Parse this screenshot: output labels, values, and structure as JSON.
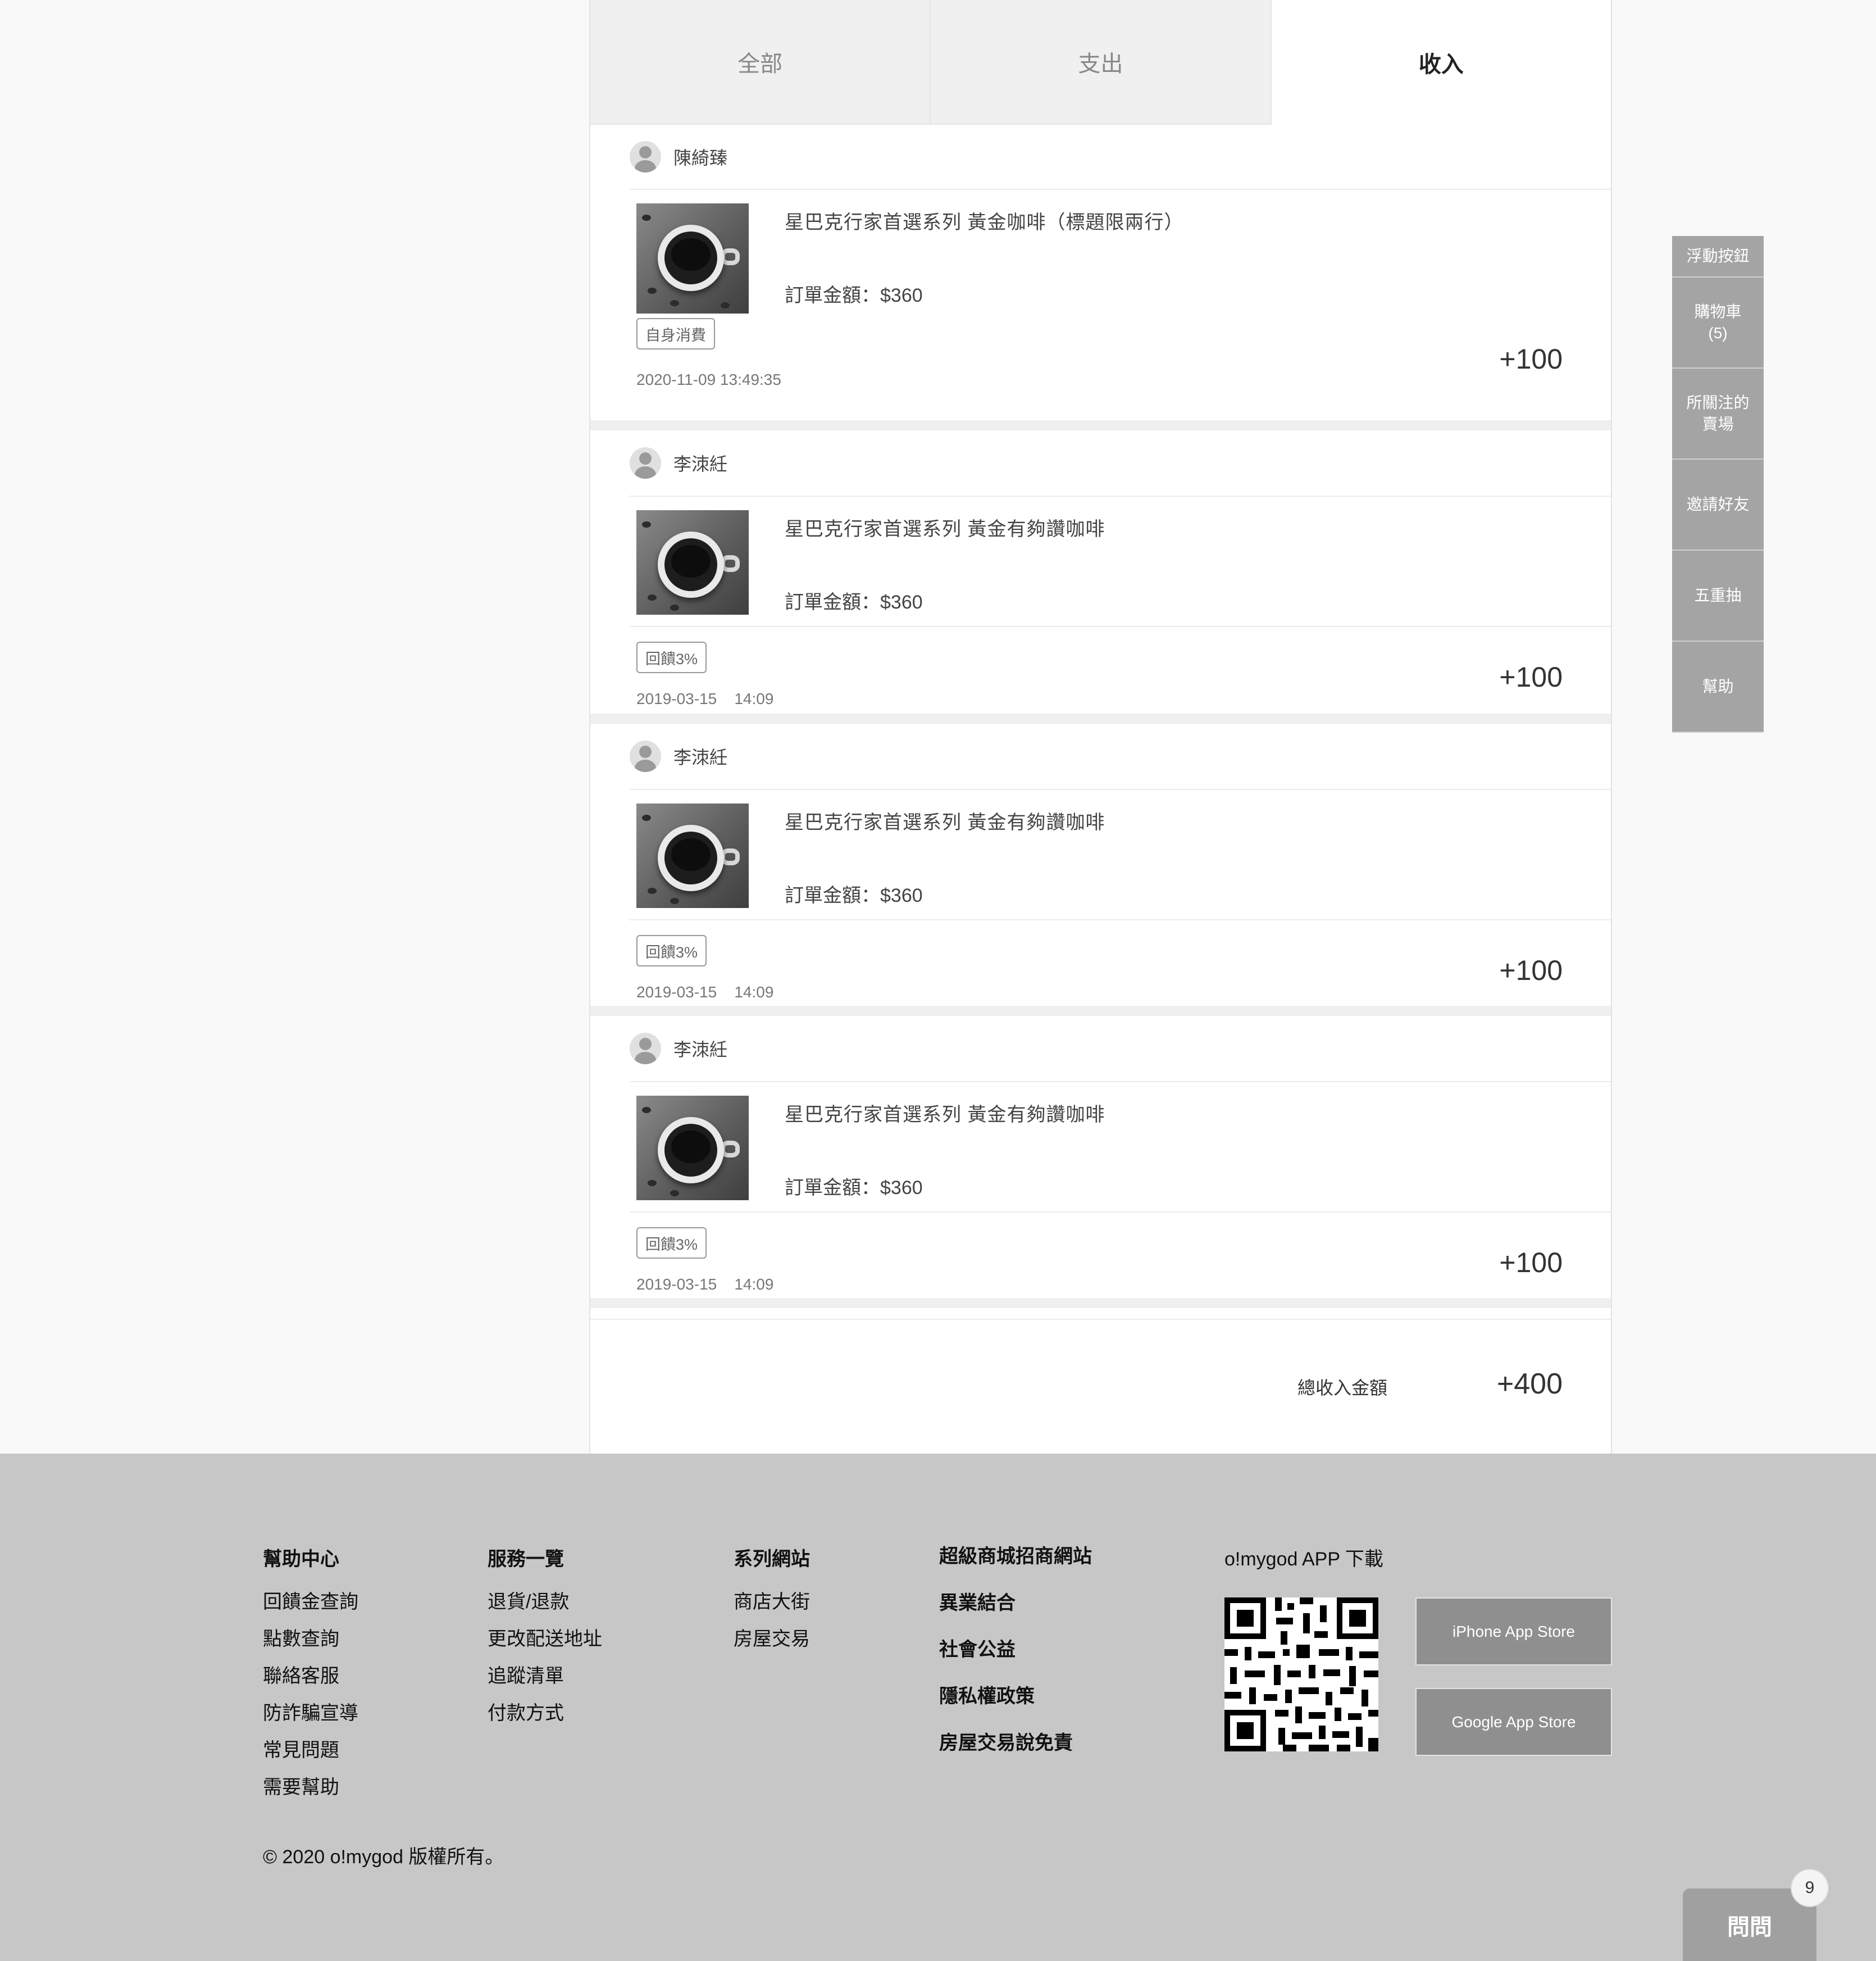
{
  "tabs": [
    {
      "label": "全部",
      "active": false
    },
    {
      "label": "支出",
      "active": false
    },
    {
      "label": "收入",
      "active": true
    }
  ],
  "entries": [
    {
      "user": "陳綺臻",
      "product_title": "星巴克行家首選系列 黃金咖啡（標題限兩行）",
      "price": "訂單金額：$360",
      "tag": "自身消費",
      "date": "2020-11-09 13:49:35",
      "amount": "+100"
    },
    {
      "user": "李洓紝",
      "product_title": "星巴克行家首選系列 黃金有夠讚咖啡",
      "price": "訂單金額：$360",
      "tag": "回饋3%",
      "date": "2019-03-15    14:09",
      "amount": "+100"
    },
    {
      "user": "李洓紝",
      "product_title": "星巴克行家首選系列 黃金有夠讚咖啡",
      "price": "訂單金額：$360",
      "tag": "回饋3%",
      "date": "2019-03-15    14:09",
      "amount": "+100"
    },
    {
      "user": "李洓紝",
      "product_title": "星巴克行家首選系列 黃金有夠讚咖啡",
      "price": "訂單金額：$360",
      "tag": "回饋3%",
      "date": "2019-03-15    14:09",
      "amount": "+100"
    }
  ],
  "total": {
    "label": "總收入金額",
    "value": "+400"
  },
  "side_menu": [
    {
      "label": "浮動按鈕"
    },
    {
      "label": "購物車\n(5)"
    },
    {
      "label": "所關注的\n賣場"
    },
    {
      "label": "邀請好友"
    },
    {
      "label": "五重抽"
    },
    {
      "label": "幫助"
    }
  ],
  "footer": {
    "col1": {
      "title": "幫助中心",
      "links": [
        "回饋金查詢",
        "點數查詢",
        "聯絡客服",
        "防詐騙宣導",
        "常見問題",
        "需要幫助"
      ]
    },
    "col2": {
      "title": "服務一覽",
      "links": [
        "退貨/退款",
        "更改配送地址",
        "追蹤清單",
        "付款方式"
      ]
    },
    "col3": {
      "title": "系列網站",
      "links": [
        "商店大街",
        "房屋交易"
      ]
    },
    "col4": {
      "links": [
        "超級商城招商網站",
        "異業結合",
        "社會公益",
        "隱私權政策",
        "房屋交易說免責"
      ]
    },
    "app_title": "o!mygod APP 下載",
    "iphone_store": "iPhone App Store",
    "google_store": "Google App Store",
    "copyright": "© 2020 o!mygod 版權所有。"
  },
  "ask": {
    "label": "問問",
    "badge": "9"
  }
}
